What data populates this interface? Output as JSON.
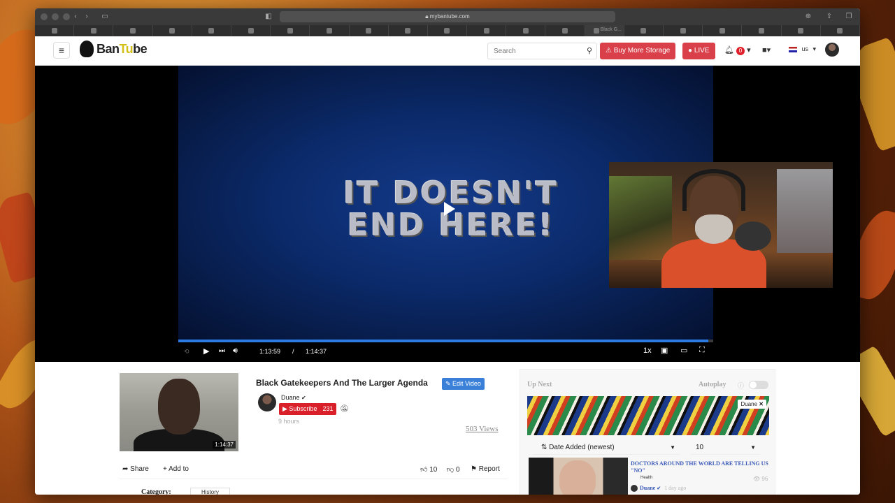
{
  "browser": {
    "url": "mybantube.com",
    "active_tab_label": "Black G..."
  },
  "header": {
    "logo_text_a": "Ban",
    "logo_text_b": "Tu",
    "logo_text_c": "be",
    "search_placeholder": "Search",
    "buy_storage_label": "Buy More Storage",
    "live_label": "LIVE",
    "notification_count": "0",
    "language": "us"
  },
  "player": {
    "overlay_text_line1": "IT DOESN'T",
    "overlay_text_line2": "END HERE!",
    "current_time": "1:13:59",
    "separator": "/",
    "duration": "1:14:37",
    "progress": 0.9915,
    "speed": "1x"
  },
  "video": {
    "thumb_duration": "1:14:37",
    "thumb_overlay": "",
    "title": "Black Gatekeepers And The Larger Agenda",
    "edit_label": "Edit Video",
    "channel_name": "Duane",
    "subscribe_label": "Subscribe",
    "subscriber_count": "231",
    "posted_ago": "9 hours",
    "views": "503 Views",
    "share_label": "Share",
    "add_to_label": "Add to",
    "likes": "10",
    "dislikes": "0",
    "report_label": "Report",
    "category_label": "Category:",
    "category_value": "History"
  },
  "upnext": {
    "title": "Up Next",
    "autoplay_label": "Autoplay",
    "banner_tag": "Duane",
    "sort_value": "Date Added (newest)",
    "count_value": "10",
    "item": {
      "title": "DOCTORS AROUND THE WORLD ARE TELLING US \"NO\"",
      "category": "Health",
      "views": "96",
      "channel": "Duane",
      "ago": "1 day ago"
    }
  }
}
